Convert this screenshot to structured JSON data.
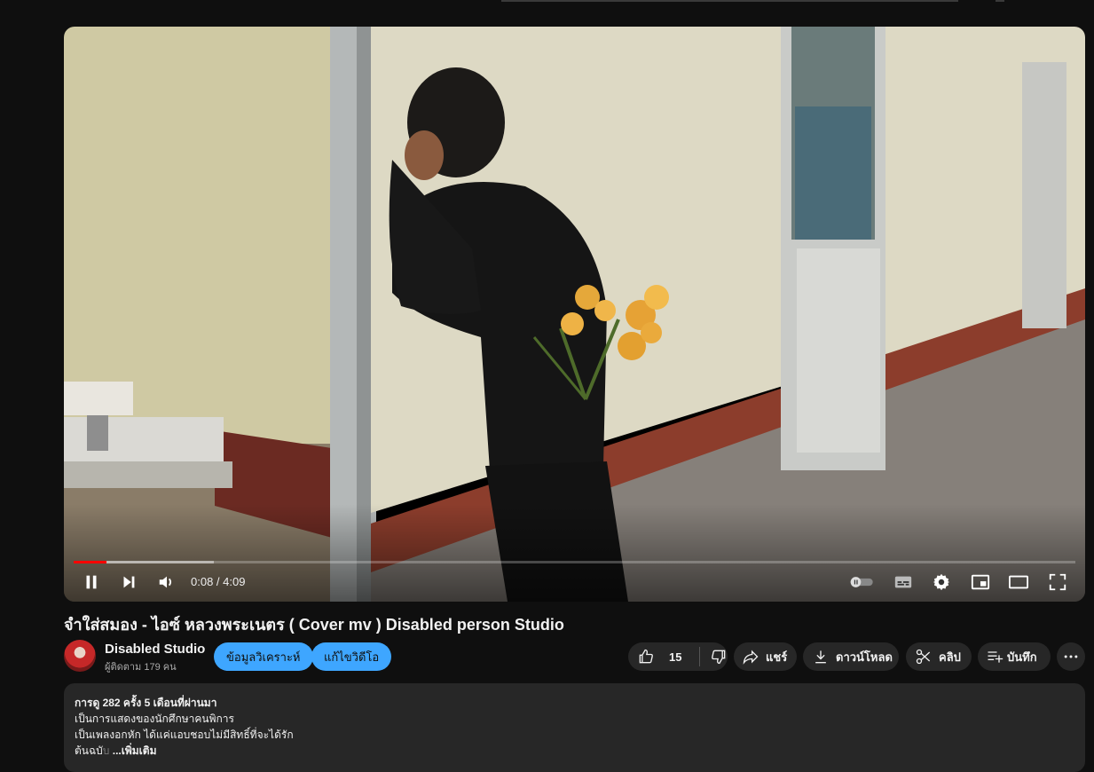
{
  "player": {
    "time_current": "0:08",
    "time_separator": " / ",
    "time_total": "4:09",
    "progress": 0.033,
    "buffered": 0.14
  },
  "video": {
    "title": "จำใส่สมอง - ไอซ์ หลวงพระเนตร ( Cover mv ) Disabled person Studio"
  },
  "channel": {
    "name": "Disabled Studio",
    "subscribers": "ผู้ติดตาม 179 คน",
    "analytics_label": "ข้อมูลวิเคราะห์",
    "edit_label": "แก้ไขวิดีโอ"
  },
  "actions": {
    "like_count": "15",
    "share_label": "แชร์",
    "download_label": "ดาวน์โหลด",
    "clip_label": "คลิป",
    "save_label": "บันทึก"
  },
  "description": {
    "stats": "การดู 282 ครั้ง  5 เดือนที่ผ่านมา",
    "line1": "เป็นการแสดงของนักศึกษาคนพิการ",
    "line2": "เป็นเพลงอกหัก ได้แค่แอบชอบไม่มีสิทธิ์ที่จะได้รัก",
    "line3_start": "ต้นฉบั",
    "line3_faded": "บ ",
    "more_label": "...เพิ่มเติม"
  },
  "colors": {
    "background": "#0f0f0f",
    "accent_red": "#ff0000",
    "pill_blue": "#3ea6ff",
    "pill_gray": "#272727"
  }
}
